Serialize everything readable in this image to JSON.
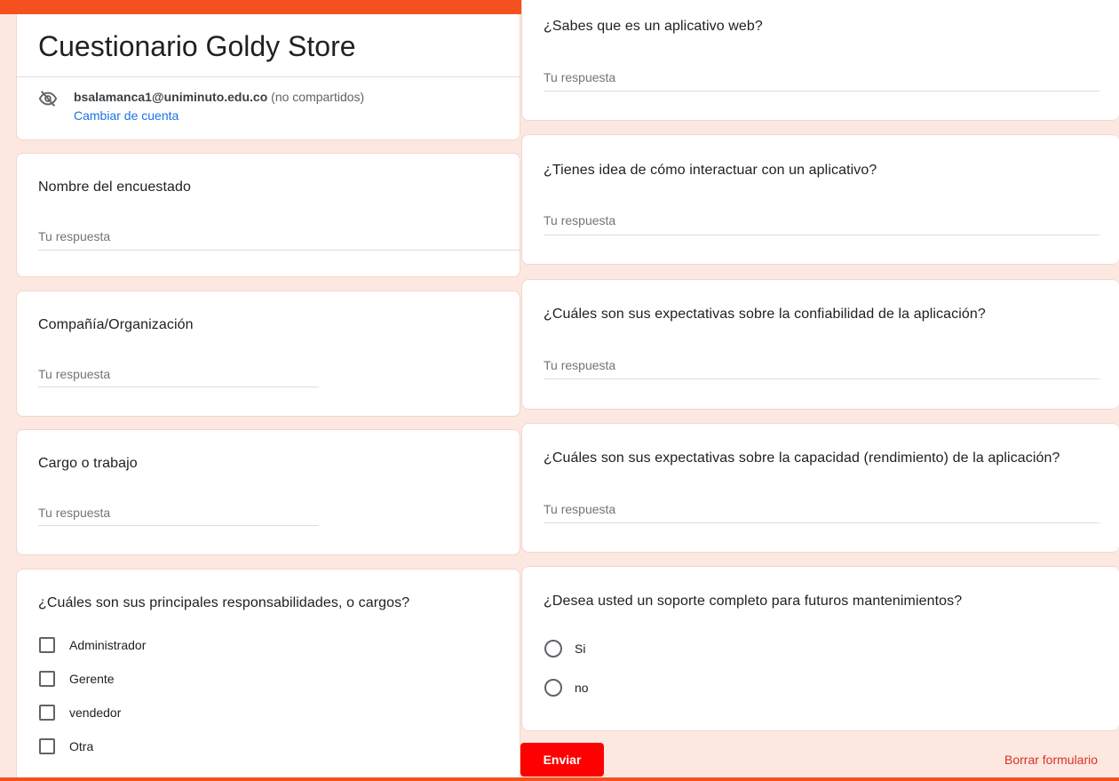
{
  "form": {
    "title": "Cuestionario Goldy Store",
    "account": {
      "email": "bsalamanca1@uniminuto.edu.co",
      "share_note": "(no compartidos)",
      "switch_label": "Cambiar de cuenta"
    },
    "answer_placeholder": "Tu respuesta"
  },
  "left_questions": [
    {
      "title": "Nombre del encuestado",
      "placeholder": "Tu respuesta"
    },
    {
      "title": "Compañía/Organización",
      "placeholder": "Tu respuesta"
    },
    {
      "title": "Cargo o trabajo",
      "placeholder": "Tu respuesta"
    }
  ],
  "checkbox_question": {
    "title": "¿Cuáles son sus principales responsabilidades, o cargos?",
    "options": [
      "Administrador",
      "Gerente",
      "vendedor",
      "Otra"
    ]
  },
  "right_questions": [
    {
      "title": "¿Sabes que es un aplicativo web?",
      "placeholder": "Tu respuesta"
    },
    {
      "title": "¿Tienes idea de cómo interactuar con un aplicativo?",
      "placeholder": "Tu respuesta"
    },
    {
      "title": "¿Cuáles son sus expectativas sobre la confiabilidad de la aplicación?",
      "placeholder": "Tu respuesta"
    },
    {
      "title": "¿Cuáles son sus expectativas sobre la capacidad (rendimiento) de la aplicación?",
      "placeholder": "Tu respuesta"
    }
  ],
  "radio_question": {
    "title": "¿Desea usted un soporte completo para futuros mantenimientos?",
    "options": [
      "Si",
      "no"
    ]
  },
  "actions": {
    "submit_label": "Enviar",
    "clear_label": "Borrar formulario"
  },
  "colors": {
    "accent": "#f4511e",
    "background": "#fde8e1",
    "submit": "#ff0000",
    "link": "#1a73e8",
    "clear": "#d93025"
  },
  "icons": {
    "account_visibility": "eye-off-icon"
  }
}
